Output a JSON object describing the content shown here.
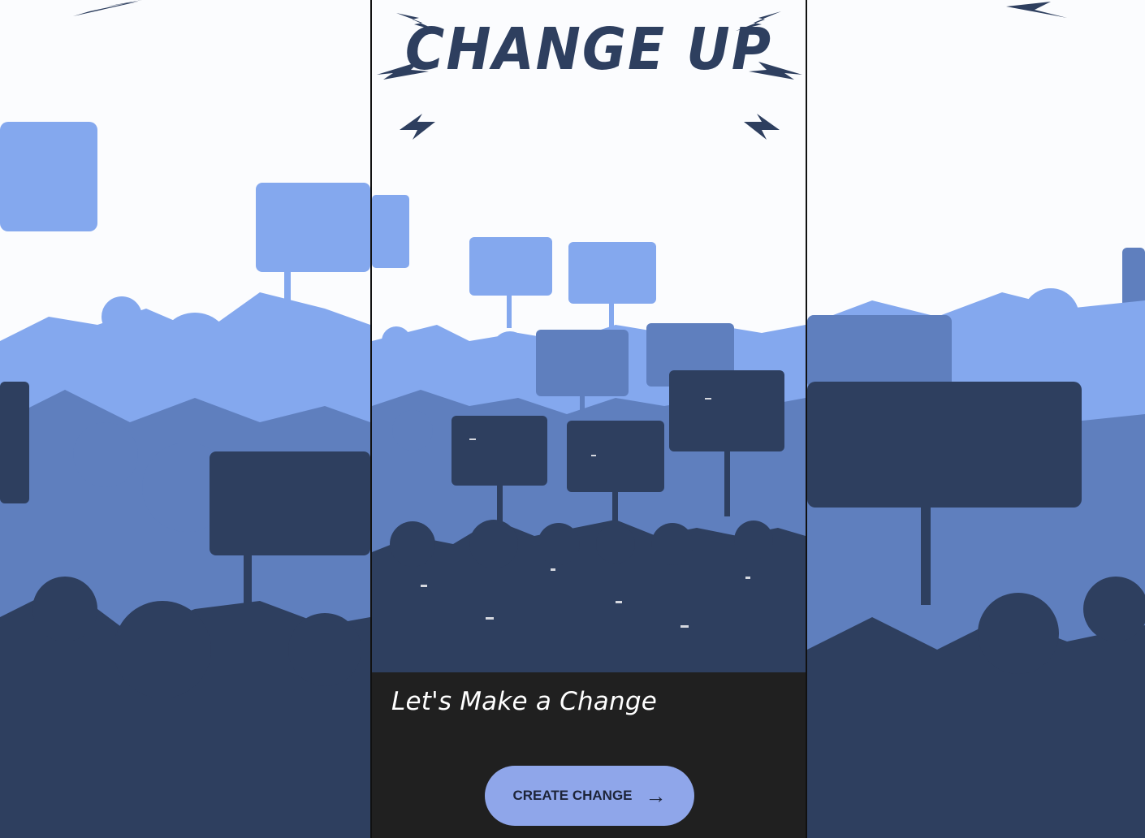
{
  "app": {
    "title": "CHANGE UP"
  },
  "onboarding": {
    "tagline": "Let's Make a Change"
  },
  "actions": {
    "create_change_label": "CREATE CHANGE",
    "create_change_icon": "arrow-right-icon"
  },
  "colors": {
    "dark_navy": "#2e3f5f",
    "mid_blue": "#5f7fbe",
    "light_blue": "#84a8ee",
    "cta_bg": "#8fa6ea",
    "panel_bg": "#202020"
  }
}
